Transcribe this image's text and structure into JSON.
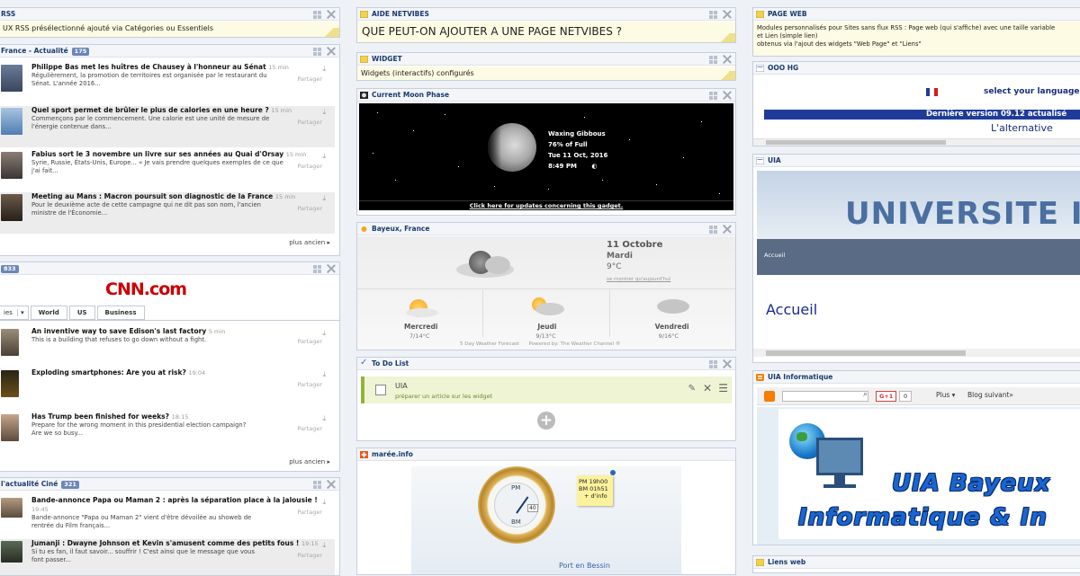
{
  "col1": {
    "rss": {
      "title": "RSS",
      "text": "UX RSS  présélectionné  ajouté via Catégories ou Essentiels"
    },
    "france": {
      "title": "France - Actualité",
      "count": "175",
      "items": [
        {
          "title": "Philippe Bas met les huîtres de Chausey à l'honneur au Sénat",
          "time": "15 min",
          "desc1": "Régulièrement, la promotion de territoires est organisée par le restaurant du",
          "desc2": "Sénat. L'année 2016..."
        },
        {
          "title": "Quel sport permet de brûler le plus de calories en une heure ?",
          "time": "15 min",
          "desc1": "Commençons par le commencement. Une calorie est une unité de mesure de",
          "desc2": "l'énergie contenue dans..."
        },
        {
          "title": "Fabius sort le 3 novembre un livre sur ses années au Quai d'Orsay",
          "time": "15 min",
          "desc1": "Syrie, Russie, États-Unis, Europe... « Je vais prendre quelques exemples de ce que",
          "desc2": "j'ai fait..."
        },
        {
          "title": "Meeting au Mans : Macron poursuit son diagnostic de la France",
          "time": "15 min",
          "desc1": "Pour le deuxième acte de cette campagne qui ne dit pas son nom, l'ancien",
          "desc2": "ministre de l'Économie..."
        }
      ],
      "share": "Partager",
      "more": "plus ancien"
    },
    "cnn": {
      "count": "833",
      "logo": "CNN.com",
      "tabs": [
        "ies",
        "World",
        "US",
        "Business"
      ],
      "items": [
        {
          "title": "An inventive way to save Edison's last factory",
          "time": "5 min",
          "desc1": "This is a building that refuses to go down without a fight.",
          "desc2": ""
        },
        {
          "title": "Exploding smartphones: Are you at risk?",
          "time": "19:04",
          "desc1": "",
          "desc2": ""
        },
        {
          "title": "Has Trump been finished for weeks?",
          "time": "18:15",
          "desc1": "Prepare for the wrong moment in this presidential election campaign?",
          "desc2": "Are we so busy..."
        }
      ],
      "more": "plus ancien"
    },
    "cine": {
      "title": "l'actualité Ciné",
      "count": "321",
      "items": [
        {
          "title": "Bande-annonce Papa ou Maman 2 : après la séparation place à la jalousie !",
          "time": "19:45",
          "desc1": "Bande-annonce \"Papa ou Maman 2\" vient d'être dévoilée au showeb de",
          "desc2": "rentrée du Film français..."
        },
        {
          "title": "Jumanji : Dwayne Johnson et Kevin s'amusent comme des petits fous !",
          "time": "19:15",
          "desc1": "Si tu es fan, il faut savoir... souffrir ! C'est ainsi que le message que vous",
          "desc2": "font passer..."
        }
      ]
    }
  },
  "col2": {
    "aide": {
      "title": "AIDE NETVIBES",
      "text": "QUE PEUT-ON AJOUTER  A UNE PAGE NETVIBES ?"
    },
    "widget": {
      "title": "WIDGET",
      "text": "Widgets (interactifs) configurés"
    },
    "moon": {
      "title": "Current Moon Phase",
      "phase": "Waxing Gibbous",
      "percent": "76% of Full",
      "date": "Tue 11 Oct, 2016",
      "time": "8:49 PM",
      "link": "Click here for updates concerning this gadget."
    },
    "weather": {
      "title": "Bayeux, France",
      "date": "11 Octobre",
      "day": "Mardi",
      "temp": "9°C",
      "link": "se montrer qu'aujourd'hui",
      "days": [
        {
          "name": "Mercredi",
          "temp": "7/14°C"
        },
        {
          "name": "Jeudi",
          "temp": "9/13°C"
        },
        {
          "name": "Vendredi",
          "temp": "9/16°C"
        }
      ],
      "footer1": "5 Day Weather Forecast",
      "footer2": "Powered by: The Weather Channel ®"
    },
    "todo": {
      "title": "To Do List",
      "item": "UIA",
      "sub": "préparer un article sur les widget"
    },
    "maree": {
      "title": "marée.info",
      "pm": "PM 19h00",
      "bm": "BM 01h51",
      "info": "+ d'info",
      "pm_dial": "PM",
      "bm_dial": "BM",
      "num": "40",
      "place": "Port en Bessin"
    }
  },
  "col3": {
    "pageweb": {
      "title": "PAGE WEB",
      "line1": "Modules personnalisés  pour Sites sans flux RSS : Page web (qui s'affiche) avec une taille variable",
      "line2": "et Lien (simple lien)",
      "line3": "obtenus via l'ajout  des widgets \"Web Page\" et \"Liens\""
    },
    "ooo": {
      "title": "OOO HG",
      "lang": "select your language",
      "version": "Dernière  version 09.12  actualisé",
      "alt": "L'alternative"
    },
    "uia": {
      "title": "UIA",
      "banner": "UNIVERSITE IN",
      "nav": "Accueil",
      "heading": "Accueil"
    },
    "uiainfo": {
      "title": "UIA Informatique",
      "gplus": "G+1",
      "gcount": "0",
      "plus": "Plus ▾",
      "next": "Blog suivant»",
      "line1": "UIA  Bayeux",
      "line2": "Informatique & In"
    },
    "liens": {
      "title": "Liens web"
    }
  }
}
